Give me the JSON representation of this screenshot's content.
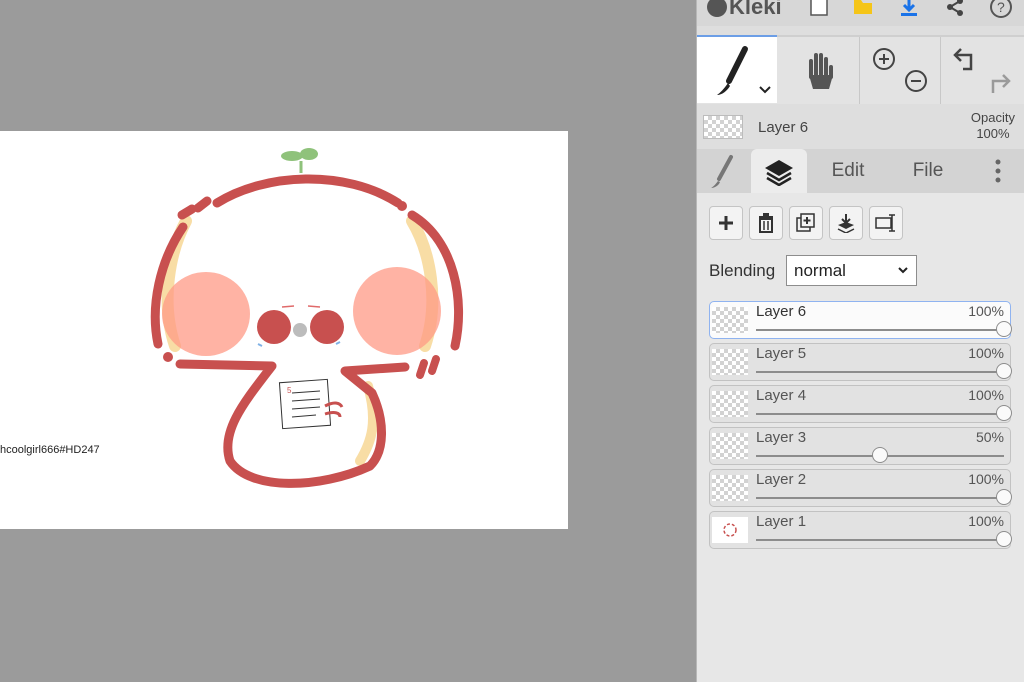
{
  "app": {
    "name": "Kleki"
  },
  "topbar": {
    "icons": [
      "new-file-icon",
      "open-folder-icon",
      "download-icon",
      "share-icon",
      "help-icon"
    ],
    "accent": "#1a73e8",
    "folder_color": "#f5c518"
  },
  "tools": {
    "brush": "brush-icon",
    "hand": "hand-icon",
    "zoom_in": "zoom-in-icon",
    "zoom_out": "zoom-out-icon",
    "undo": "undo-icon",
    "redo": "redo-icon"
  },
  "layer_info": {
    "name": "Layer 6",
    "opacity_label": "Opacity",
    "opacity_value": "100%"
  },
  "tabs": {
    "edit": "Edit",
    "file": "File"
  },
  "layer_buttons": [
    "add-layer",
    "delete-layer",
    "duplicate-layer",
    "merge-down",
    "rename-layer"
  ],
  "blending": {
    "label": "Blending",
    "value": "normal"
  },
  "layers": [
    {
      "name": "Layer 6",
      "opacity": "100%",
      "level": 1.0,
      "selected": true
    },
    {
      "name": "Layer 5",
      "opacity": "100%",
      "level": 1.0
    },
    {
      "name": "Layer 4",
      "opacity": "100%",
      "level": 1.0
    },
    {
      "name": "Layer 3",
      "opacity": "50%",
      "level": 0.5
    },
    {
      "name": "Layer 2",
      "opacity": "100%",
      "level": 1.0
    },
    {
      "name": "Layer 1",
      "opacity": "100%",
      "level": 1.0
    }
  ],
  "canvas": {
    "signature": "hcoolgirl666#HD247",
    "drawing_colors": {
      "outline": "#c8504f",
      "cream": "#f7d99b",
      "blush": "#ff9a86",
      "sprout": "#8fc27b",
      "tear": "#7fb2e6"
    }
  }
}
